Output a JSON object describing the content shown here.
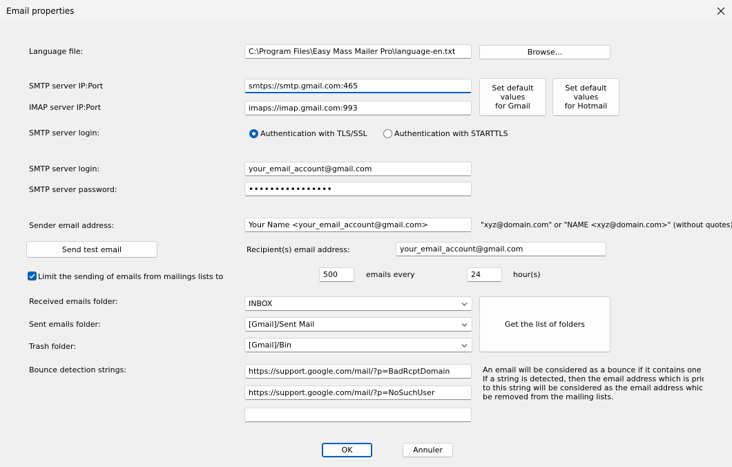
{
  "window": {
    "title": "Email properties"
  },
  "language": {
    "label": "Language file:",
    "value": "C:\\Program Files\\Easy Mass Mailer Pro\\language-en.txt",
    "browse": "Browse..."
  },
  "smtp": {
    "server_label": "SMTP server IP:Port",
    "server_value": "smtps://smtp.gmail.com:465",
    "imap_label": "IMAP server IP:Port",
    "imap_value": "imaps://imap.gmail.com:993",
    "gmail_btn_1": "Set default values",
    "gmail_btn_2": "for Gmail",
    "hotmail_btn_1": "Set default values",
    "hotmail_btn_2": "for Hotmail",
    "login_mode_label": "SMTP server login:",
    "radio_tls": "Authentication with TLS/SSL",
    "radio_starttls": "Authentication with STARTTLS",
    "login_label": "SMTP server login:",
    "login_value": "your_email_account@gmail.com",
    "password_label": "SMTP server password:",
    "password_value": "••••••••••••••••"
  },
  "sender": {
    "label": "Sender email address:",
    "value": "Your Name <your_email_account@gmail.com>",
    "hint": "\"xyz@domain.com\" or \"NAME <xyz@domain.com>\" (without quotes)"
  },
  "test": {
    "button": "Send test email",
    "recipient_label": "Recipient(s) email address:",
    "recipient_value": "your_email_account@gmail.com"
  },
  "limit": {
    "label": "Limit the sending of emails from mailings lists to",
    "count": "500",
    "every": "emails every",
    "hours": "24",
    "unit": "hour(s)"
  },
  "folders": {
    "received_label": "Received emails folder:",
    "received_value": "INBOX",
    "sent_label": "Sent emails folder:",
    "sent_value": "[Gmail]/Sent Mail",
    "trash_label": "Trash folder:",
    "trash_value": "[Gmail]/Bin",
    "get_list": "Get the list of folders"
  },
  "bounce": {
    "label": "Bounce detection strings:",
    "values": [
      "https://support.google.com/mail/?p=BadRcptDomain",
      "https://support.google.com/mail/?p=NoSuchUser",
      ""
    ],
    "hint_lines": [
      "An email will be considered as a bounce if it contains one of these s",
      "If a string is detected, then the email address which is prior",
      "to this string will be considered as the email address which must",
      "be removed from the mailing lists."
    ]
  },
  "footer": {
    "ok": "OK",
    "cancel": "Annuler"
  },
  "colors": {
    "accent": "#005fb8",
    "background": "#f0f0f0"
  }
}
